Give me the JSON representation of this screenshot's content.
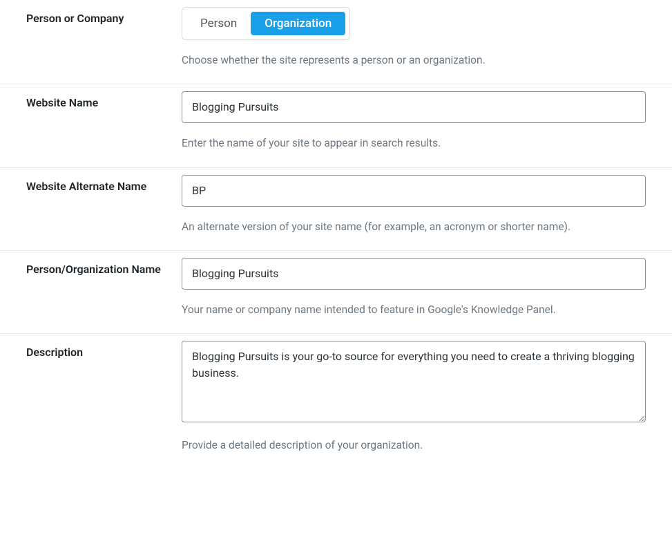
{
  "fields": {
    "person_or_company": {
      "label": "Person or Company",
      "option_person": "Person",
      "option_organization": "Organization",
      "hint": "Choose whether the site represents a person or an organization."
    },
    "website_name": {
      "label": "Website Name",
      "value": "Blogging Pursuits",
      "hint": "Enter the name of your site to appear in search results."
    },
    "website_alt_name": {
      "label": "Website Alternate Name",
      "value": "BP",
      "hint": "An alternate version of your site name (for example, an acronym or shorter name)."
    },
    "person_org_name": {
      "label": "Person/Organization Name",
      "value": "Blogging Pursuits",
      "hint": "Your name or company name intended to feature in Google's Knowledge Panel."
    },
    "description": {
      "label": "Description",
      "value": "Blogging Pursuits is your go-to source for everything you need to create a thriving blogging business.",
      "hint": "Provide a detailed description of your organization."
    }
  }
}
